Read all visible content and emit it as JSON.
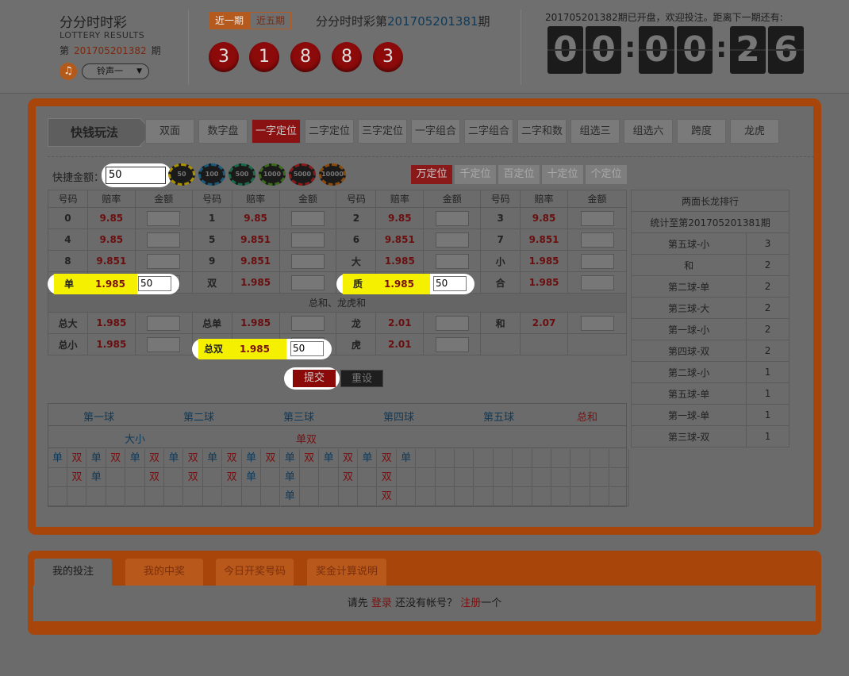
{
  "header": {
    "title_cn": "分分时时彩",
    "title_en": "LOTTERY RESULTS",
    "issue_prefix": "第",
    "issue_num": "201705201382",
    "issue_suffix": "期",
    "sound_label": "铃声一",
    "period_tabs": [
      "近一期",
      "近五期"
    ],
    "current_issue_prefix": "分分时时彩第",
    "current_issue": "201705201381",
    "current_issue_suffix": "期",
    "balls": [
      "3",
      "1",
      "8",
      "8",
      "3"
    ],
    "notice": "201705201382期已开盘，欢迎投注。距离下一期还有:",
    "countdown": [
      "0",
      "0",
      "0",
      "0",
      "2",
      "6"
    ]
  },
  "play": {
    "label": "快钱玩法",
    "tabs": [
      "双面",
      "数字盘",
      "一字定位",
      "二字定位",
      "三字定位",
      "一字组合",
      "二字组合",
      "二字和数",
      "组选三",
      "组选六",
      "跨度",
      "龙虎"
    ],
    "active_tab": "一字定位"
  },
  "quick": {
    "label": "快捷金额：",
    "value": "50",
    "chips": [
      "50",
      "100",
      "500",
      "1000",
      "5000",
      "10000"
    ],
    "positions": [
      "万定位",
      "千定位",
      "百定位",
      "十定位",
      "个定位"
    ]
  },
  "bet_table": {
    "headers": [
      "号码",
      "赔率",
      "金额"
    ],
    "rows": [
      [
        [
          "0",
          "9.85",
          ""
        ],
        [
          "1",
          "9.85",
          ""
        ],
        [
          "2",
          "9.85",
          ""
        ],
        [
          "3",
          "9.85",
          ""
        ]
      ],
      [
        [
          "4",
          "9.85",
          ""
        ],
        [
          "5",
          "9.851",
          ""
        ],
        [
          "6",
          "9.851",
          ""
        ],
        [
          "7",
          "9.851",
          ""
        ]
      ],
      [
        [
          "8",
          "9.851",
          ""
        ],
        [
          "9",
          "9.851",
          ""
        ],
        [
          "大",
          "1.985",
          ""
        ],
        [
          "小",
          "1.985",
          ""
        ]
      ],
      [
        [
          "单",
          "1.985",
          "50"
        ],
        [
          "双",
          "1.985",
          ""
        ],
        [
          "质",
          "1.985",
          "50"
        ],
        [
          "合",
          "1.985",
          ""
        ]
      ]
    ],
    "section_title": "总和、龙虎和",
    "rows2": [
      [
        [
          "总大",
          "1.985",
          ""
        ],
        [
          "总单",
          "1.985",
          ""
        ],
        [
          "龙",
          "2.01",
          ""
        ],
        [
          "和",
          "2.07",
          ""
        ]
      ],
      [
        [
          "总小",
          "1.985",
          ""
        ],
        [
          "总双",
          "1.985",
          "50"
        ],
        [
          "虎",
          "2.01",
          ""
        ],
        [
          "",
          "",
          ""
        ]
      ]
    ],
    "submit": "提交",
    "reset": "重设"
  },
  "long_table": {
    "title": "两面长龙排行",
    "subtitle": "统计至第201705201381期",
    "rows": [
      [
        "第五球-小",
        "3"
      ],
      [
        "和",
        "2"
      ],
      [
        "第二球-单",
        "2"
      ],
      [
        "第三球-大",
        "2"
      ],
      [
        "第一球-小",
        "2"
      ],
      [
        "第四球-双",
        "2"
      ],
      [
        "第二球-小",
        "1"
      ],
      [
        "第五球-单",
        "1"
      ],
      [
        "第一球-单",
        "1"
      ],
      [
        "第三球-双",
        "1"
      ]
    ]
  },
  "trend": {
    "balls": [
      "第一球",
      "第二球",
      "第三球",
      "第四球",
      "第五球",
      "总和"
    ],
    "types": [
      "大小",
      "单双"
    ],
    "row1": [
      "单",
      "双",
      "单",
      "双",
      "单",
      "双",
      "单",
      "双",
      "单",
      "双",
      "单",
      "双",
      "单",
      "双",
      "单",
      "双",
      "单",
      "双",
      "单"
    ],
    "row2": [
      "",
      "双",
      "单",
      "",
      "",
      "双",
      "",
      "双",
      "",
      "双",
      "单",
      "",
      "单",
      "",
      "",
      "双",
      "",
      "双",
      ""
    ],
    "row3": [
      "",
      "",
      "",
      "",
      "",
      "",
      "",
      "",
      "",
      "",
      "",
      "",
      "单",
      "",
      "",
      "",
      "",
      "双",
      ""
    ]
  },
  "bottom": {
    "tabs": [
      "我的投注",
      "我的中奖",
      "今日开奖号码",
      "奖金计算说明"
    ],
    "msg1": "请先",
    "login": "登录",
    "msg2": "还没有帐号？",
    "register": "注册",
    "msg3": "一个"
  }
}
